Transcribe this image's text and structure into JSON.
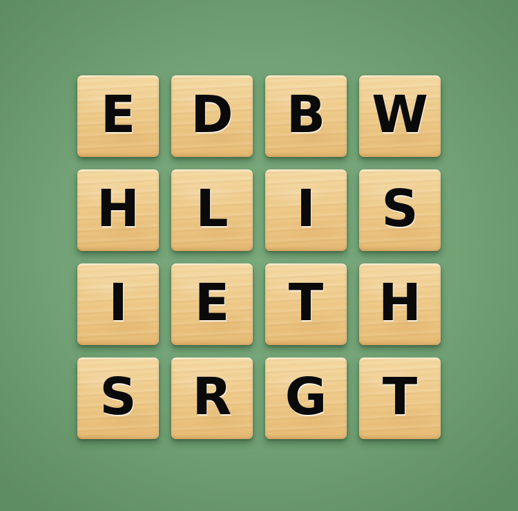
{
  "board": {
    "rows": [
      [
        "E",
        "D",
        "B",
        "W"
      ],
      [
        "H",
        "L",
        "I",
        "S"
      ],
      [
        "I",
        "E",
        "T",
        "H"
      ],
      [
        "S",
        "R",
        "G",
        "T"
      ]
    ]
  }
}
